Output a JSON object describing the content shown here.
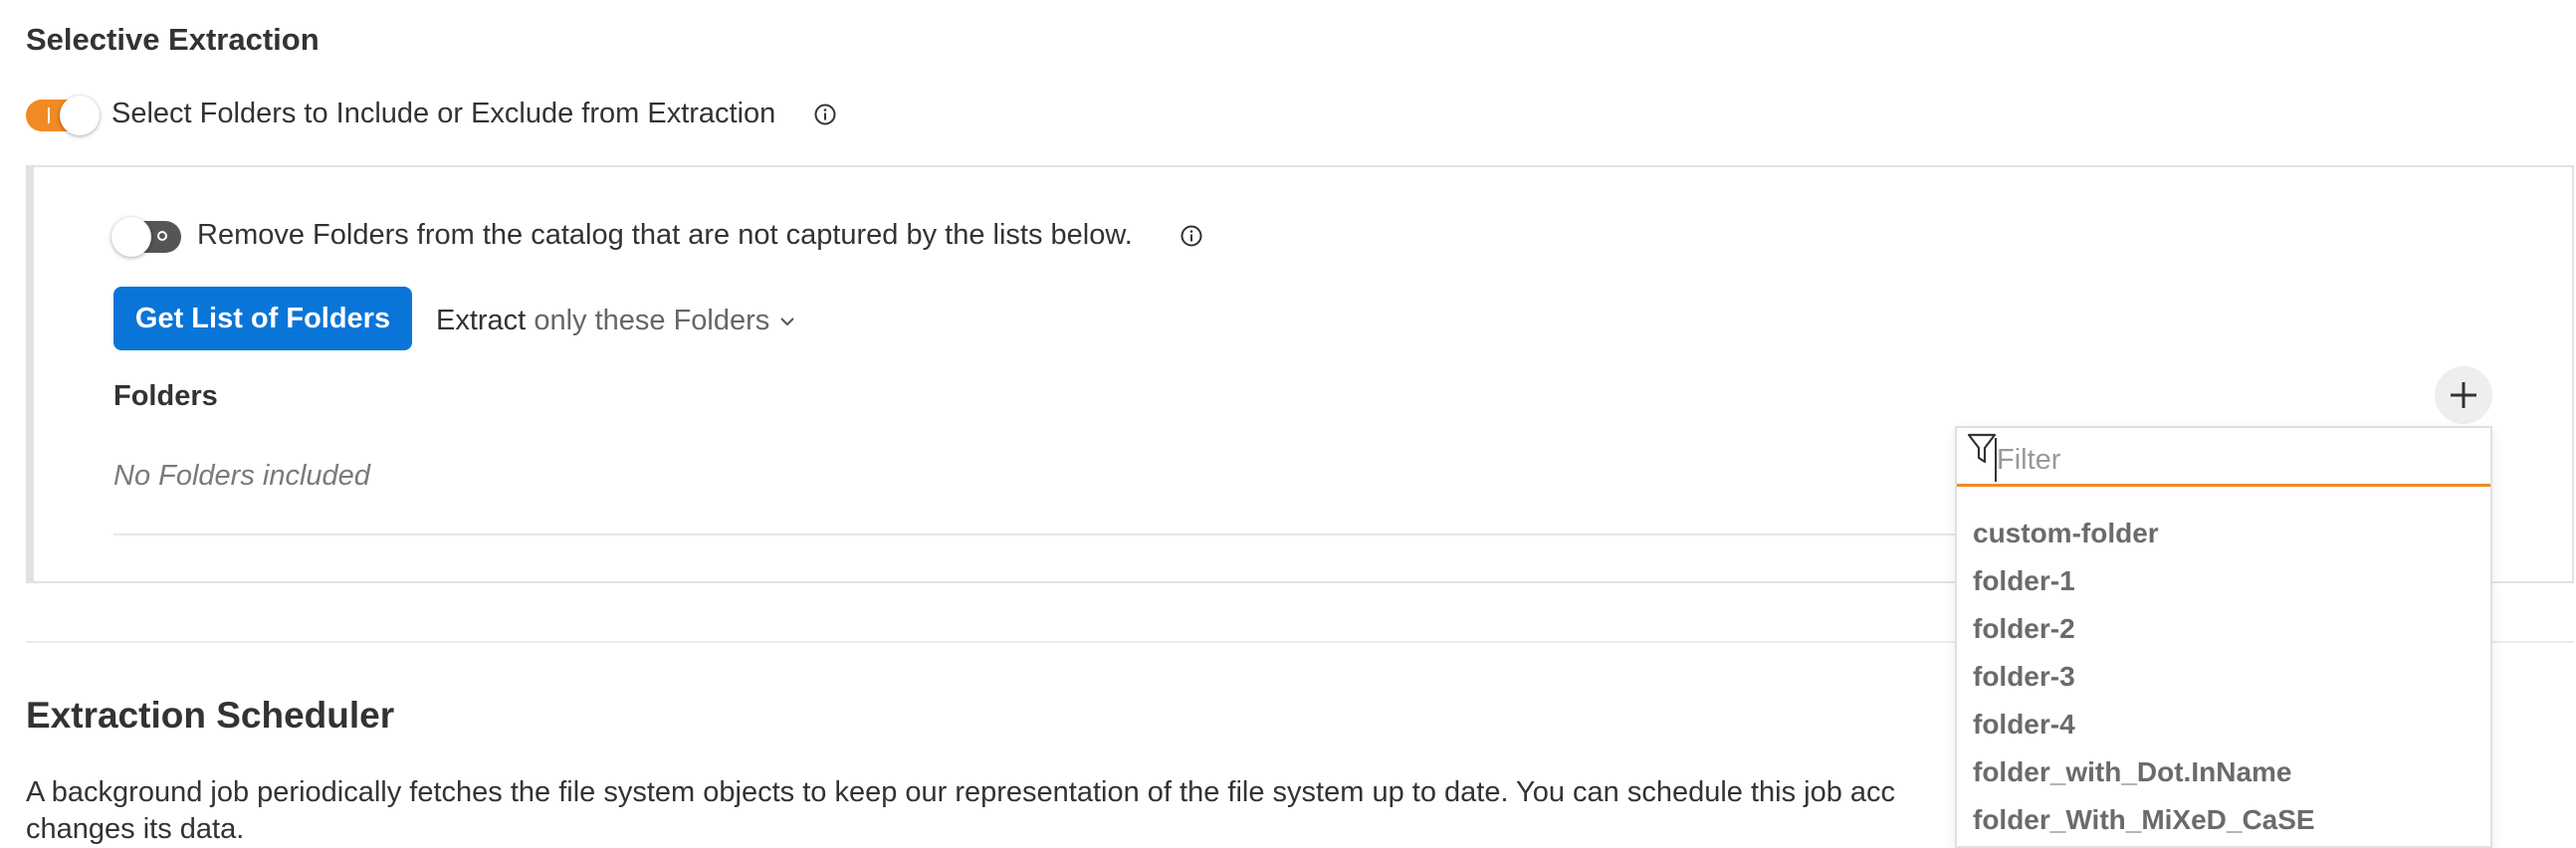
{
  "selective": {
    "title": "Selective Extraction",
    "toggle_label": "Select Folders to Include or Exclude from Extraction",
    "toggle_on": true,
    "accent_color": "#f08a24"
  },
  "panel": {
    "remove_toggle_label": "Remove Folders from the catalog that are not captured by the lists below.",
    "remove_toggle_on": false,
    "get_list_button": "Get List of Folders",
    "extract_prefix": "Extract",
    "extract_mode": "only these Folders",
    "folders_heading": "Folders",
    "empty_message": "No Folders included",
    "button_color": "#0a75d8"
  },
  "filter_popup": {
    "placeholder": "Filter",
    "value": "",
    "options": [
      "custom-folder",
      "folder-1",
      "folder-2",
      "folder-3",
      "folder-4",
      "folder_with_Dot.InName",
      "folder_With_MiXeD_CaSE"
    ]
  },
  "scheduler": {
    "title": "Extraction Scheduler",
    "description_line1": "A background job periodically fetches the file system objects to keep our representation of the file system up to date. You can schedule this job acc",
    "description_line2": "changes its data."
  },
  "icons": {
    "info": "info-icon",
    "add": "plus-icon",
    "filter": "filter-icon",
    "chevron": "chevron-down-icon"
  }
}
